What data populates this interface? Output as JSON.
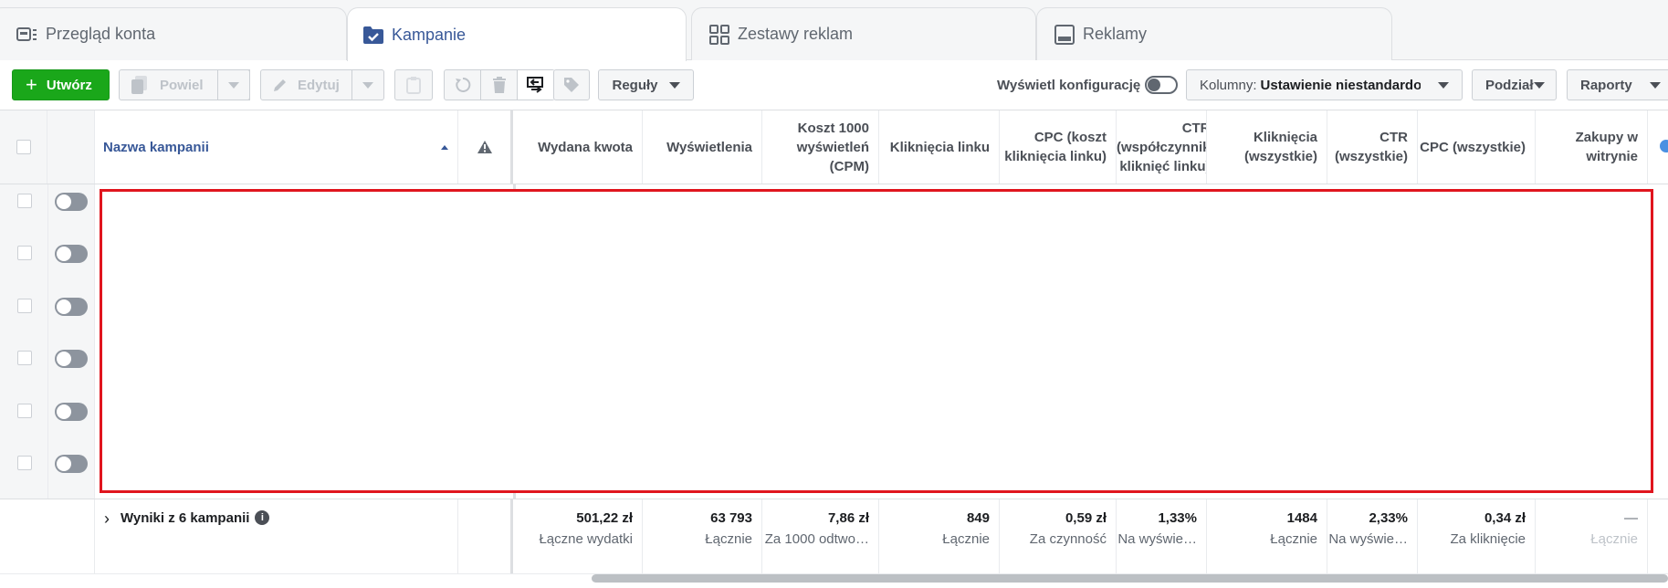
{
  "tabs": [
    {
      "label": "Przegląd konta",
      "icon": "account-overview-icon",
      "active": false
    },
    {
      "label": "Kampanie",
      "icon": "folder-check-icon",
      "active": true
    },
    {
      "label": "Zestawy reklam",
      "icon": "grid-icon",
      "active": false
    },
    {
      "label": "Reklamy",
      "icon": "ad-preview-icon",
      "active": false
    }
  ],
  "toolbar": {
    "create_label": "Utwórz",
    "duplicate_label": "Powiel",
    "edit_label": "Edytuj",
    "rules_label": "Reguły",
    "config_label": "Wyświetl konfigurację",
    "columns_prefix": "Kolumny:",
    "columns_value": "Ustawienie niestandardowe",
    "breakdown_label": "Podział",
    "reports_label": "Raporty"
  },
  "table": {
    "columns": {
      "name": "Nazwa kampanii",
      "spent": "Wydana kwota",
      "impressions": "Wyświetlenia",
      "cpm": "Koszt 1000 wyświetleń (CPM)",
      "link_clicks": "Kliknięcia linku",
      "cpc_link": "CPC (koszt kliknięcia linku)",
      "ctr_link": "CTR (współczynnik kliknięć linku)",
      "clicks_all": "Kliknięcia (wszystkie)",
      "ctr_all": "CTR (wszystkie)",
      "cpc_all": "CPC (wszystkie)",
      "purchases": "Zakupy w witrynie"
    },
    "row_count": 6
  },
  "summary": {
    "label": "Wyniki z 6 kampanii",
    "spent": {
      "value": "501,22 zł",
      "label": "Łączne wydatki"
    },
    "impressions": {
      "value": "63 793",
      "label": "Łącznie"
    },
    "cpm": {
      "value": "7,86 zł",
      "label": "Za 1000 odtwo…"
    },
    "link_clicks": {
      "value": "849",
      "label": "Łącznie"
    },
    "cpc_link": {
      "value": "0,59 zł",
      "label": "Za czynność"
    },
    "ctr_link": {
      "value": "1,33%",
      "label": "Na wyświe…"
    },
    "clicks_all": {
      "value": "1484",
      "label": "Łącznie"
    },
    "ctr_all": {
      "value": "2,33%",
      "label": "Na wyświe…"
    },
    "cpc_all": {
      "value": "0,34 zł",
      "label": "Za kliknięcie"
    },
    "purchases": {
      "value": "—",
      "label": "Łącznie"
    }
  },
  "colors": {
    "accent": "#385898",
    "create": "#1aa71a",
    "redaction": "#e0151e"
  }
}
